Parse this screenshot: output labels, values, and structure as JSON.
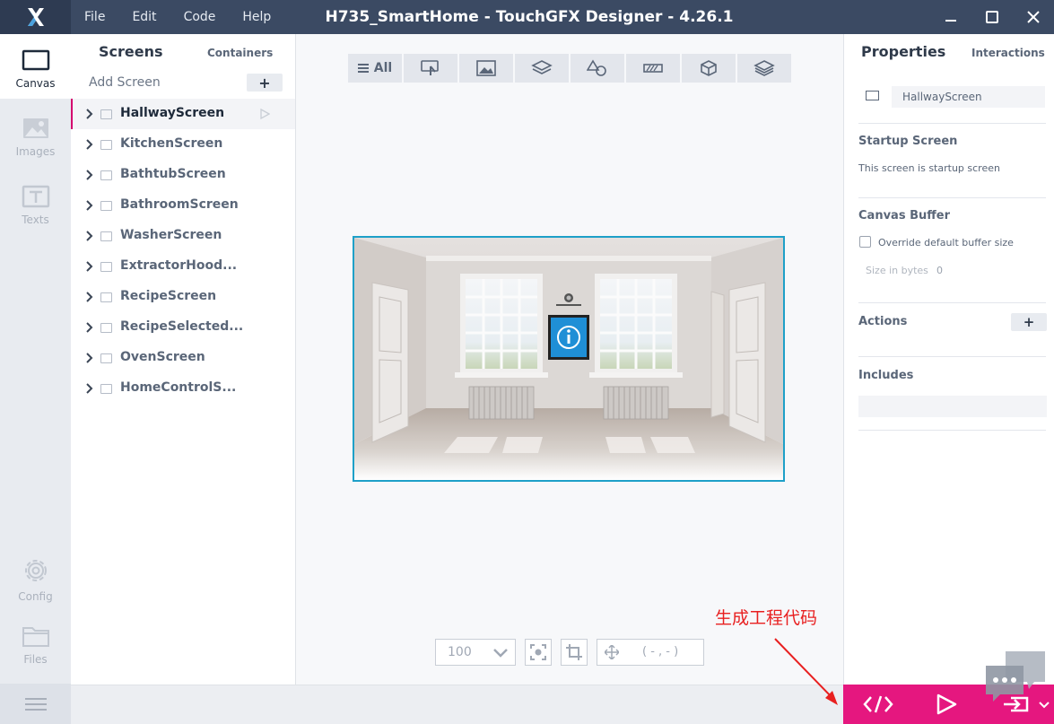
{
  "app": {
    "title": "H735_SmartHome - TouchGFX Designer - 4.26.1",
    "menu": [
      "File",
      "Edit",
      "Code",
      "Help"
    ]
  },
  "nav": {
    "canvas": "Canvas",
    "images": "Images",
    "texts": "Texts",
    "config": "Config",
    "files": "Files"
  },
  "screens_panel": {
    "tab_screens": "Screens",
    "tab_containers": "Containers",
    "add_screen": "Add Screen",
    "add_button": "+",
    "items": [
      "HallwayScreen",
      "KitchenScreen",
      "BathtubScreen",
      "BathroomScreen",
      "WasherScreen",
      "ExtractorHood...",
      "RecipeScreen",
      "RecipeSelected...",
      "OvenScreen",
      "HomeControlS..."
    ]
  },
  "canvas": {
    "filter_all": "All",
    "zoom": "100",
    "coords": "( - , - )"
  },
  "properties": {
    "tab_properties": "Properties",
    "tab_interactions": "Interactions",
    "screen_name": "HallwayScreen",
    "startup_title": "Startup Screen",
    "startup_text": "This screen is startup screen",
    "buffer_title": "Canvas Buffer",
    "buffer_override": "Override default buffer size",
    "size_label": "Size in bytes",
    "size_value": "0",
    "actions_title": "Actions",
    "actions_add": "+",
    "includes_title": "Includes"
  },
  "annotation": {
    "text": "生成工程代码",
    "color": "#e82020"
  },
  "colors": {
    "accent": "#e5177f",
    "titlebar": "#3b4a63",
    "selection": "#1ea0c8"
  }
}
